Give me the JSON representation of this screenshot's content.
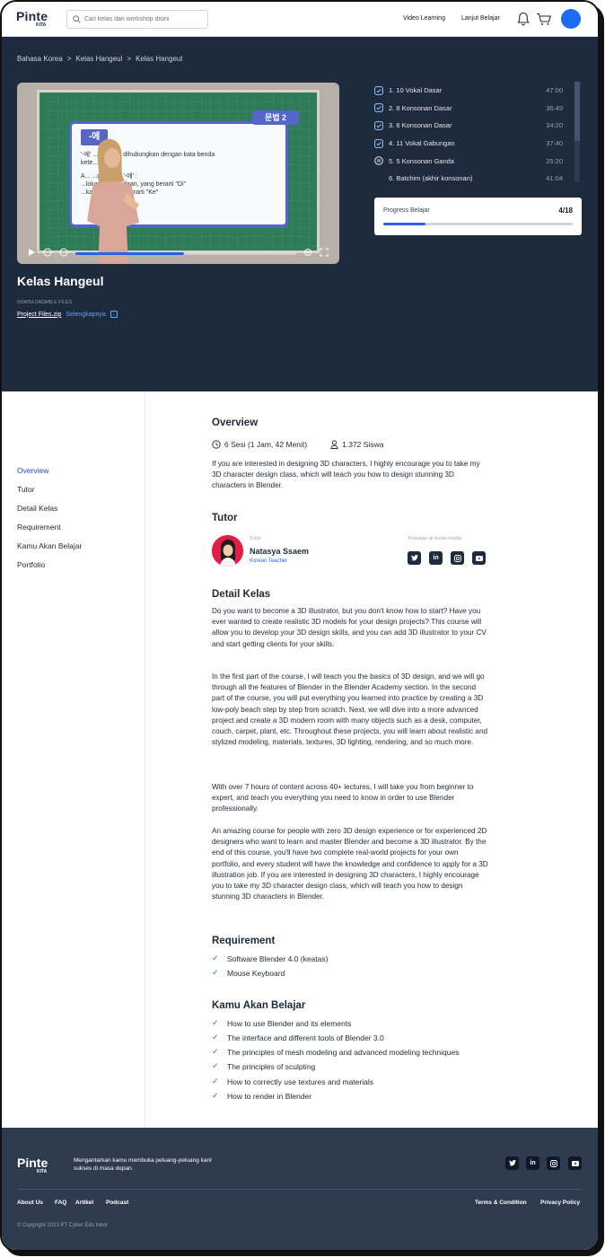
{
  "header": {
    "logo_main": "Pinte",
    "logo_sub": "KITA",
    "search_placeholder": "Cari kelas dan workshop disini",
    "nav": [
      "Video Learning",
      "Lanjut Belajar"
    ]
  },
  "breadcrumb": [
    "Bahasa Korea",
    ">",
    "Kelas Hangeul",
    ">",
    "Kelas Hangeul"
  ],
  "video": {
    "slide_tag": "문법 2",
    "slide_chip": "-에",
    "slide_lines": [
      "'-에' ...kel yang dihubungkan dengan kata benda",
      "kete...          ...pat.",
      "A...           ...ggunaan '-에' :",
      "...lokasi keberadaan, yang berarti \"Di\"",
      "...kasi tuju...    ...g berarti \"Ke\""
    ],
    "progress": 0.49
  },
  "course": {
    "title": "Kelas Hangeul",
    "downloads_label": "DOWNLOADABLE FILES",
    "file_name": "Project Files.zip",
    "more_label": "Selengkapnya"
  },
  "playlist": [
    {
      "label": "1. 10 Vokal Dasar",
      "duration": "47:00",
      "state": "done"
    },
    {
      "label": "2. 8 Konsonan Dasar",
      "duration": "36:49",
      "state": "done"
    },
    {
      "label": "3. 6 Konsonan Dasar",
      "duration": "34:20",
      "state": "done"
    },
    {
      "label": "4. 11 Vokal Gabungan",
      "duration": "37:40",
      "state": "done"
    },
    {
      "label": "5. 5 Konsonan Ganda",
      "duration": "25:20",
      "state": "playing"
    },
    {
      "label": "6. Batchim (akhir konsonan)",
      "duration": "41:04",
      "state": "none"
    }
  ],
  "progress_card": {
    "label": "Progress Belajar",
    "count": "4/18",
    "fraction": 0.222
  },
  "sidebar": [
    "Overview",
    "Tutor",
    "Detail Kelas",
    "Requirement",
    "Kamu Akan Belajar",
    "Portfolio"
  ],
  "overview": {
    "title": "Overview",
    "sessions": "6 Sesi (1 Jam, 42 Menit)",
    "students": "1.372 Siswa",
    "text": "If you are interested in designing 3D characters, I highly encourage you to take my 3D character design class, which will teach you how to design stunning 3D characters in Blender."
  },
  "tutor": {
    "title": "Tutor",
    "caption": "Tutor",
    "name": "Natasya Ssaem",
    "role": "Korean Teacher",
    "social_caption": "Temukan di social media"
  },
  "detail": {
    "title": "Detail Kelas",
    "paragraphs": [
      "Do you want to become a 3D illustrator, but you don't know how to start? Have you ever wanted to create realistic 3D models for your design projects? This course will allow you to develop your 3D design skills, and you can add 3D illustrator to your CV and start getting clients for your skills.",
      "In the first part of the course, I will teach you the basics of 3D design, and we will go through all the features of Blender in the Blender Academy section. In the second part of the course, you will put everything you learned into practice by creating a 3D low-poly beach step by step from scratch. Next, we will dive into a more advanced project and create a 3D modern room with many objects such as a desk, computer, couch, carpet, plant, etc. Throughout these projects, you will learn about realistic and stylized modeling, materials, textures, 3D lighting, rendering, and so much more.",
      "With over 7 hours of content across 40+ lectures, I will take you from beginner to expert, and teach you everything you need to know in order to use Blender professionally.",
      "An amazing course for people with zero 3D design experience or for experienced 2D designers who want to learn and master Blender and become a 3D illustrator. By the end of this course, you'll have two complete real-world projects for your own portfolio, and every student will have the knowledge and confidence to apply for a 3D illustration job. If you are interested in designing 3D characters, I highly encourage you to take my 3D character design class, which will teach you how to design stunning 3D characters in Blender."
    ]
  },
  "requirement": {
    "title": "Requirement",
    "items": [
      "Software Blender 4.0 (keatas)",
      "Mouse Keyboard"
    ]
  },
  "learn": {
    "title": "Kamu Akan Belajar",
    "items": [
      "How to use Blender and its elements",
      "The interface and different tools of Blender 3.0",
      "The principles of mesh modeling and advanced modeling techniques",
      "The principles of sculpting",
      "How to correctly use textures and materials",
      "How to render in Blender"
    ]
  },
  "footer": {
    "logo_main": "Pinte",
    "logo_sub": "KITA",
    "tagline": "Mengantarkan kamu membuka peluang-peluang karir sukses di masa depan.",
    "links_left": [
      "About Us",
      "FAQ",
      "Artikel",
      "Podcast"
    ],
    "links_right": [
      "Terms & Condition",
      "Privacy Policy"
    ],
    "copyright": "© Copyright 2023 PT Cyber Edu Inkor"
  },
  "colors": {
    "accent": "#2563eb",
    "hero_bg": "#1e2a3d",
    "footer_bg": "#2e3b4e"
  }
}
